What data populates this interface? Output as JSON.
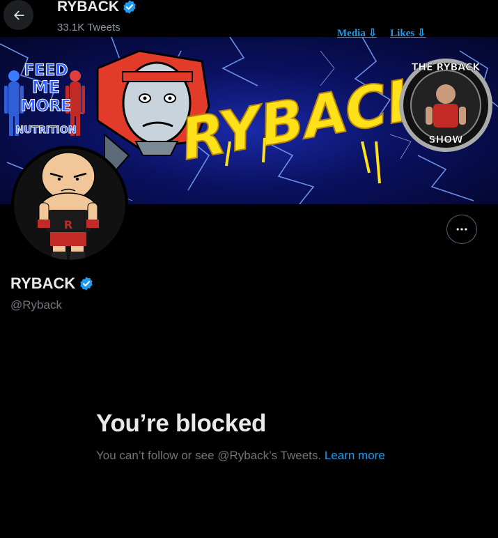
{
  "header": {
    "name": "RYBACK",
    "tweet_count": "33.1K Tweets",
    "links": [
      "Media ⇩",
      "Likes ⇩"
    ]
  },
  "banner": {
    "left_logo_lines": [
      "FEED",
      "ME",
      "MORE",
      "NUTRITION"
    ],
    "logo_text": "RYBACK",
    "badge_lines": [
      "THE RYBACK",
      "SHOW"
    ]
  },
  "profile": {
    "name": "RYBACK",
    "handle": "@Ryback",
    "verified": true
  },
  "blocked": {
    "title": "You’re blocked",
    "message": "You can’t follow or see @Ryback’s Tweets.",
    "link_text": "Learn more"
  },
  "colors": {
    "background": "#000000",
    "accent": "#1d9bf0",
    "muted": "#71767b",
    "text": "#e7e9ea"
  }
}
